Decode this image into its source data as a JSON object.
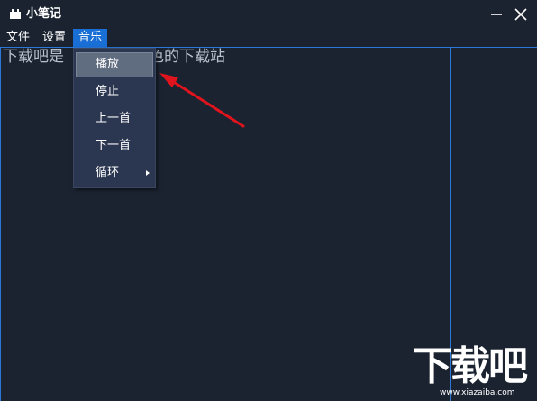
{
  "window": {
    "title": "小笔记",
    "app_icon": "notebook-icon",
    "minimize_icon": "minimize-icon",
    "close_icon": "close-icon"
  },
  "menubar": {
    "items": [
      {
        "label": "文件"
      },
      {
        "label": "设置"
      },
      {
        "label": "音乐",
        "active": true
      }
    ]
  },
  "editor": {
    "text_before": "下载吧是",
    "text_after": "色的下载站"
  },
  "music_menu": {
    "items": [
      {
        "label": "播放",
        "highlighted": true
      },
      {
        "label": "停止"
      },
      {
        "label": "上一首"
      },
      {
        "label": "下一首"
      },
      {
        "label": "循环",
        "has_submenu": true
      }
    ]
  },
  "annotation": {
    "arrow_color": "#e0141c",
    "icon": "red-arrow-icon"
  },
  "watermark": {
    "title": "下载吧",
    "url": "www.xiazaiba.com"
  },
  "colors": {
    "background": "#1b2331",
    "accent": "#1a6fd6",
    "menu_bg": "#2b3750",
    "menu_hover": "#606c80"
  }
}
